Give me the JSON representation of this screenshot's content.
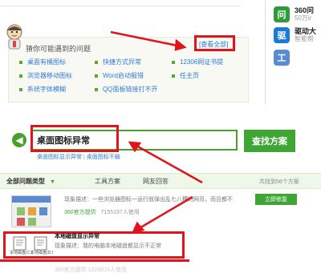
{
  "top": {
    "faint_text": ""
  },
  "sidebar": {
    "items": [
      {
        "icon": "question-bubble-icon",
        "icon_text": "问",
        "title": "360问",
        "sub": "50万ir",
        "color": "#2e9a3a"
      },
      {
        "icon": "driver-icon",
        "icon_text": "驱",
        "title": "驱动大",
        "sub": "智能帮",
        "color": "#1a7cd6"
      },
      {
        "icon": "tool-icon",
        "icon_text": "工",
        "title": "",
        "sub": "",
        "color": "#5a8ad0"
      }
    ]
  },
  "problems": {
    "title": "猜你可能遇到的问题",
    "view_all": "[查看全部]",
    "items": [
      "桌面有桶图标",
      "快捷方式异常",
      "12306网证书提",
      "浏览器移动图标",
      "Word启动报错",
      "任主页",
      "系统字体模糊",
      "QQ面板链接打不开"
    ]
  },
  "search": {
    "back_icon": "back-arrow-icon",
    "query": "桌面图标异常",
    "button_label": "查找方案",
    "related": [
      "桌面图标显示异常",
      "桌面图标不输"
    ]
  },
  "tabs": {
    "all_label": "全部问题类型",
    "tools_label": "工具方案",
    "answers_label": "网友回答",
    "count_text": "共找到56个方案"
  },
  "results": [
    {
      "desc": "现象描述：一些浏览器图标一运行就弹出乱七八糟的网页，而且都不",
      "provider": "360官方提供",
      "users": "7155197人使用",
      "button_label": "立即修复"
    },
    {
      "title": "本地磁盘显示异常",
      "desc": "现象描述：我的电脑本地磁盘都显示不正常",
      "faded": "360官方提供   1026829人使用",
      "thumbs": [
        "本地磁盘(C:)",
        "本地磁盘(D:)"
      ]
    }
  ],
  "colors": {
    "accent_green": "#3fa535",
    "highlight_red": "#e1141c",
    "link_blue": "#2f7bd6"
  }
}
